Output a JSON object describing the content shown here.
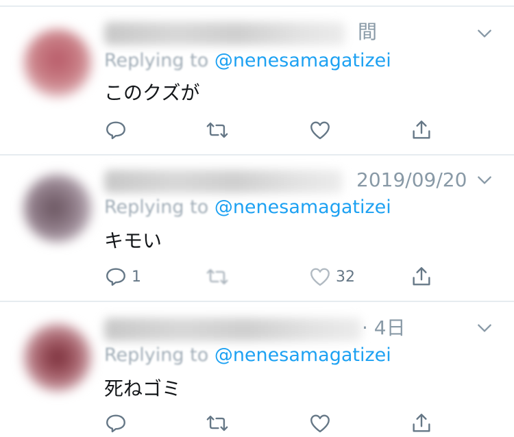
{
  "colors": {
    "accent": "#1da1f2",
    "icon": "#657786",
    "muted_text": "#8899a6",
    "divider": "#e6ecf0"
  },
  "replies": [
    {
      "timestamp": "間",
      "replying_label": "Replying to",
      "replying_handle": "@nenesamagatizei",
      "text": "このクズが",
      "reply_count": "",
      "like_count": "",
      "icons": [
        "reply-icon",
        "retweet-icon",
        "like-icon",
        "share-icon"
      ]
    },
    {
      "timestamp": "2019/09/20",
      "replying_label": "Replying to",
      "replying_handle": "@nenesamagatizei",
      "text": "キモい",
      "reply_count": "1",
      "like_count": "32",
      "icons": [
        "reply-icon",
        "retweet-icon",
        "like-icon",
        "share-icon"
      ]
    },
    {
      "timestamp": "· 4日",
      "replying_label": "Replying to",
      "replying_handle": "@nenesamagatizei",
      "text": "死ねゴミ",
      "reply_count": "",
      "like_count": "",
      "icons": [
        "reply-icon",
        "retweet-icon",
        "like-icon",
        "share-icon"
      ]
    }
  ]
}
